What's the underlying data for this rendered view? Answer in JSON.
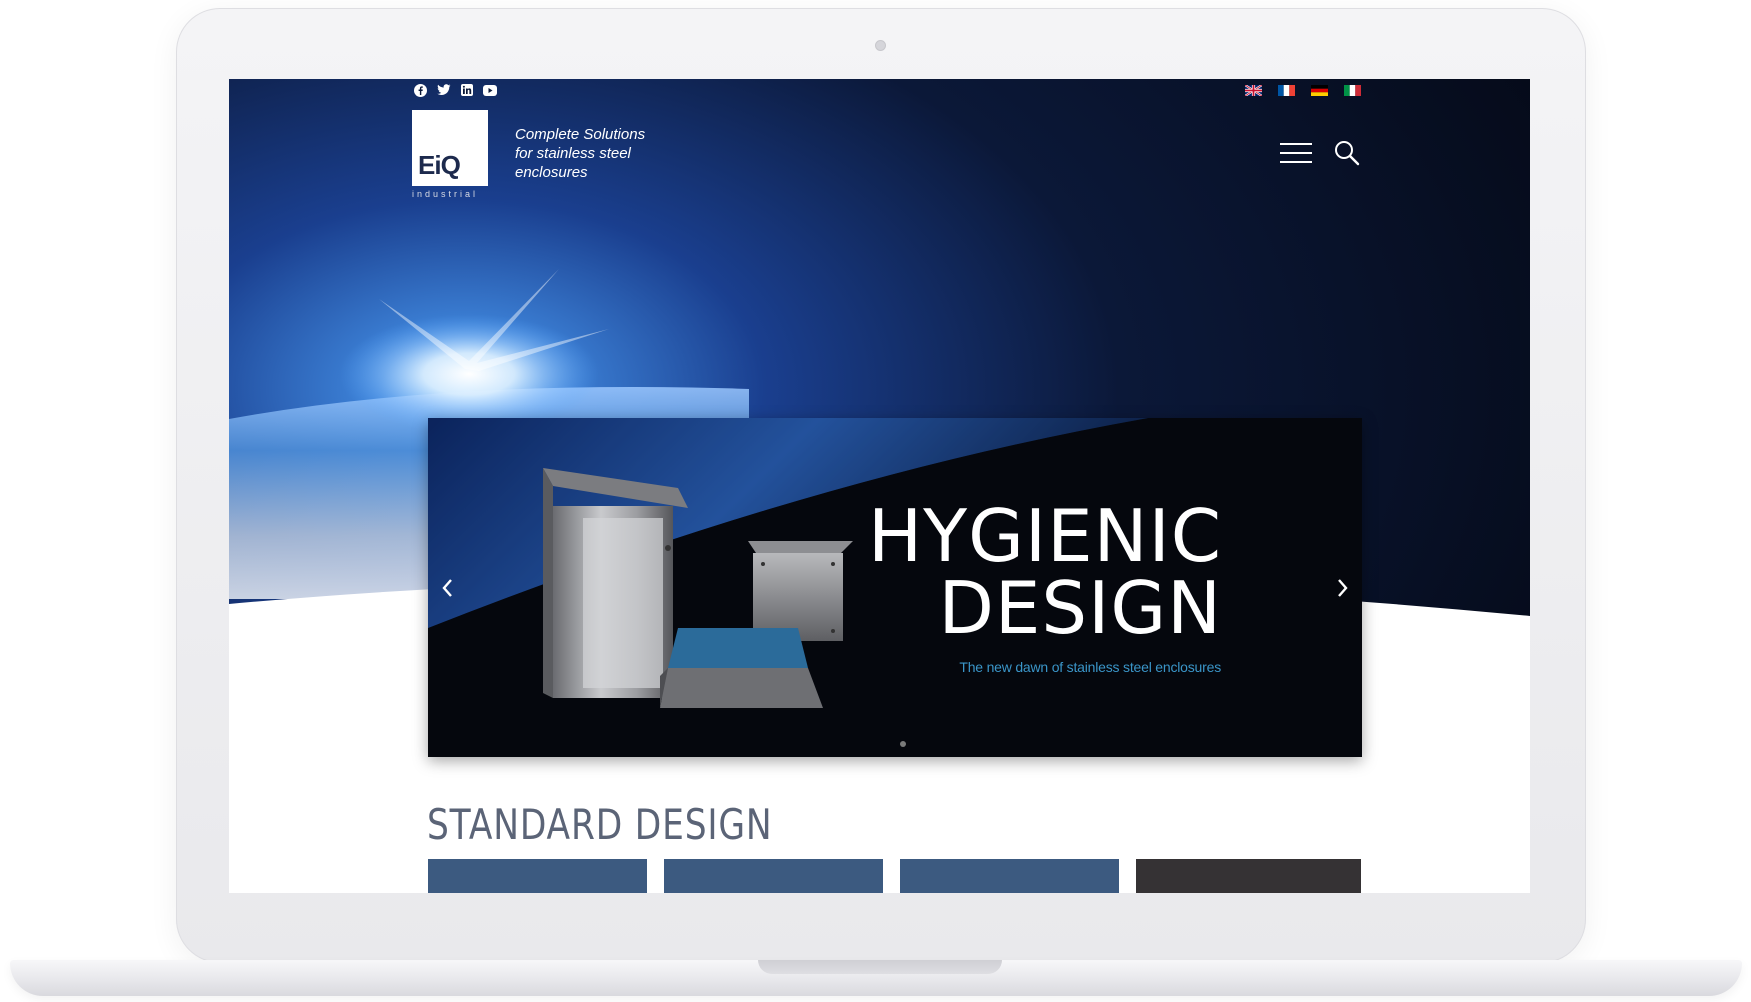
{
  "header": {
    "social": [
      {
        "icon": "facebook-icon"
      },
      {
        "icon": "twitter-icon"
      },
      {
        "icon": "linkedin-icon"
      },
      {
        "icon": "youtube-icon"
      }
    ],
    "languages": [
      {
        "icon": "uk-flag-icon"
      },
      {
        "icon": "france-flag-icon"
      },
      {
        "icon": "germany-flag-icon"
      },
      {
        "icon": "italy-flag-icon"
      }
    ],
    "logo": {
      "mark": "EiQ",
      "sub": "industrial"
    },
    "tagline": [
      "Complete Solutions",
      "for stainless steel",
      "enclosures"
    ],
    "menu_icon": "hamburger-menu-icon",
    "search_icon": "search-icon"
  },
  "slider": {
    "title_line1": "HYGIENIC",
    "title_line2": "DESIGN",
    "subtitle": "The new dawn of stainless steel enclosures",
    "prev_icon": "chevron-left-icon",
    "next_icon": "chevron-right-icon",
    "active_slide": 1,
    "slide_count": 1
  },
  "standard_design": {
    "title": "STANDARD DESIGN",
    "card_count": 4
  },
  "colors": {
    "hero_dark": "#05070d",
    "hero_blue": "#1a3f8f",
    "accent_blue": "#3a95c8",
    "card_blue": "#3c5a80",
    "section_title": "#5b6477"
  }
}
